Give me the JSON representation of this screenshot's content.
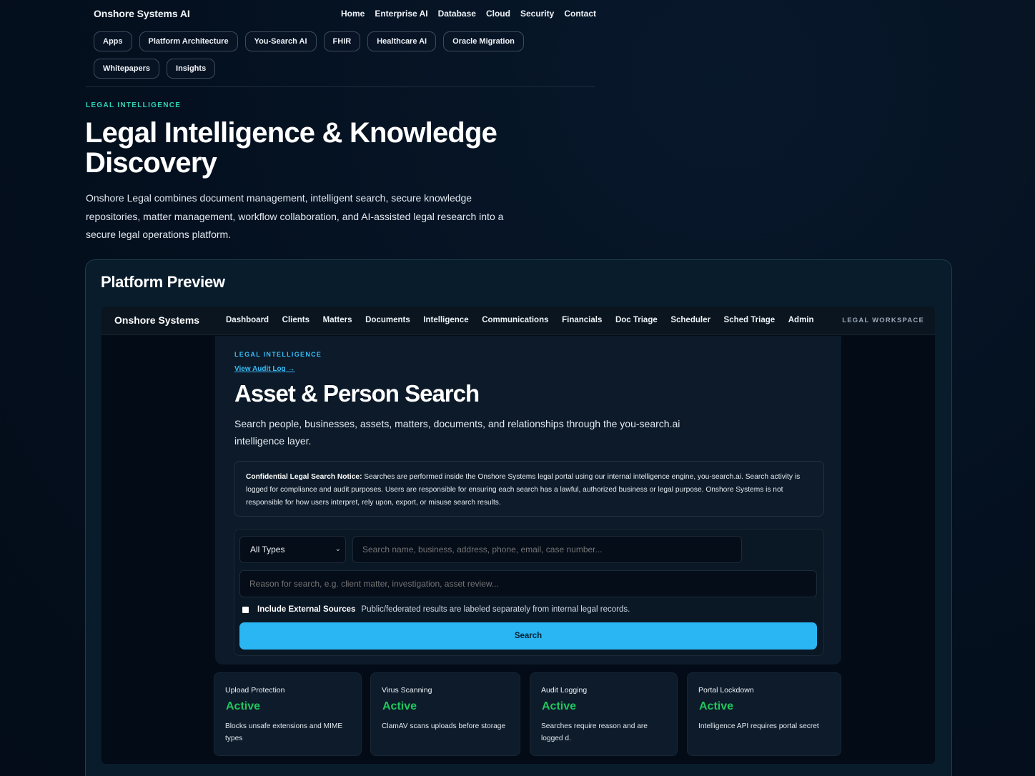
{
  "header": {
    "brand": "Onshore Systems AI",
    "nav": [
      "Home",
      "Enterprise AI",
      "Database",
      "Cloud",
      "Security",
      "Contact"
    ],
    "pills": [
      "Apps",
      "Platform Architecture",
      "You-Search AI",
      "FHIR",
      "Healthcare AI",
      "Oracle Migration",
      "Whitepapers",
      "Insights"
    ]
  },
  "hero": {
    "eyebrow": "LEGAL INTELLIGENCE",
    "title": "Legal Intelligence & Knowledge Discovery",
    "description": "Onshore Legal combines document management, intelligent search, secure knowledge repositories, matter management, workflow collaboration, and AI-assisted legal research into a secure legal operations platform."
  },
  "preview": {
    "title": "Platform Preview",
    "app": {
      "brand": "Onshore Systems",
      "nav": [
        "Dashboard",
        "Clients",
        "Matters",
        "Documents",
        "Intelligence",
        "Communications",
        "Financials",
        "Doc Triage",
        "Scheduler",
        "Sched Triage",
        "Admin"
      ],
      "workspace": "LEGAL WORKSPACE",
      "panel": {
        "eyebrow": "LEGAL INTELLIGENCE",
        "audit_link": "View Audit Log →",
        "title": "Asset & Person Search",
        "description": "Search people, businesses, assets, matters, documents, and relationships through the you-search.ai intelligence layer.",
        "notice_label": "Confidential Legal Search Notice:",
        "notice_text": " Searches are performed inside the Onshore Systems legal portal using our internal intelligence engine, you-search.ai. Search activity is logged for compliance and audit purposes. Users are responsible for ensuring each search has a lawful, authorized business or legal purpose. Onshore Systems is not responsible for how users interpret, rely upon, export, or misuse search results.",
        "type_select": "All Types",
        "query_placeholder": "Search name, business, address, phone, email, case number...",
        "reason_placeholder": "Reason for search, e.g. client matter, investigation, asset review...",
        "external_label": "Include External Sources",
        "external_help": "Public/federated results are labeled separately from internal legal records.",
        "search_button": "Search"
      },
      "status_cards": [
        {
          "title": "Upload Protection",
          "value": "Active",
          "description": "Blocks unsafe extensions and MIME types"
        },
        {
          "title": "Virus Scanning",
          "value": "Active",
          "description": "ClamAV scans uploads before storage"
        },
        {
          "title": "Audit Logging",
          "value": "Active",
          "description": "Searches require reason and are logged d."
        },
        {
          "title": "Portal Lockdown",
          "value": "Active",
          "description": "Intelligence API requires portal secret"
        }
      ]
    }
  },
  "colors": {
    "background": "#04101f",
    "accent_teal": "#2fd3b6",
    "accent_blue": "#38bdf8",
    "button": "#29b6f2",
    "status_active": "#22c55e"
  }
}
